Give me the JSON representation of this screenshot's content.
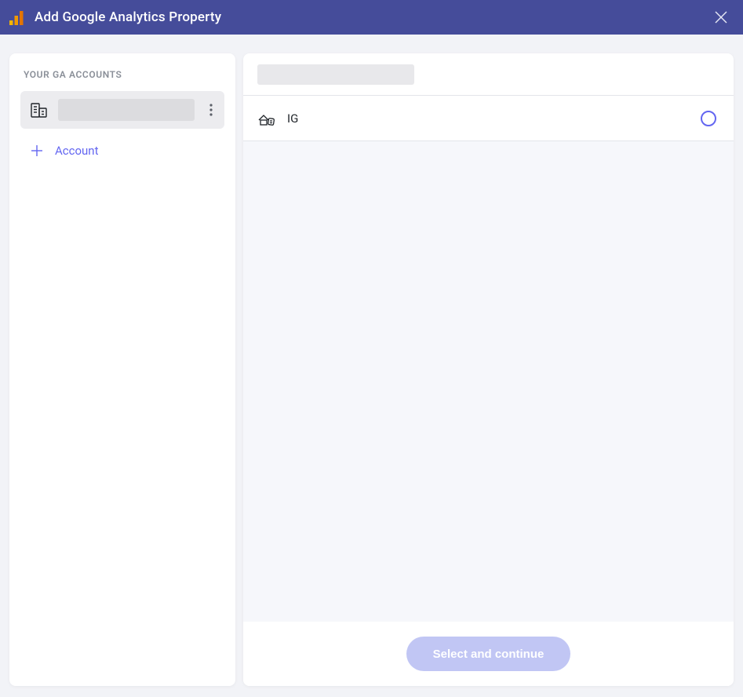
{
  "header": {
    "title": "Add Google Analytics Property"
  },
  "sidebar": {
    "section_title": "YOUR GA ACCOUNTS",
    "selected_account_name": "",
    "add_account_label": "Account"
  },
  "main": {
    "account_title": "",
    "properties": [
      {
        "name": "IG",
        "selected": false
      }
    ]
  },
  "footer": {
    "continue_label": "Select and continue"
  }
}
